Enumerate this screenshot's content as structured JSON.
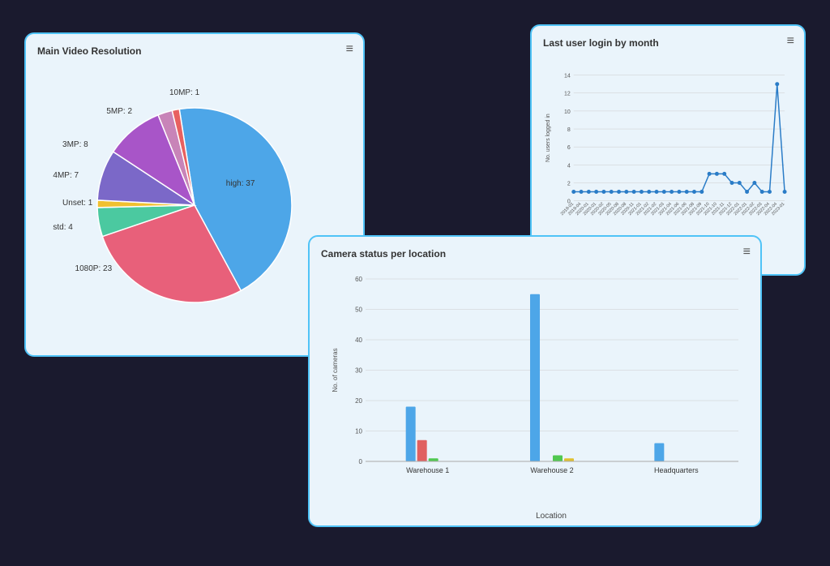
{
  "pie_card": {
    "title": "Main Video Resolution",
    "menu_icon": "≡",
    "slices": [
      {
        "label": "high: 37",
        "value": 37,
        "color": "#4da6e8",
        "labelX": "62%",
        "labelY": "44%"
      },
      {
        "label": "1080P: 23",
        "value": 23,
        "color": "#e8607a",
        "labelX": "18%",
        "labelY": "78%"
      },
      {
        "label": "std: 4",
        "value": 4,
        "color": "#4bc9a0",
        "labelX": "10%",
        "labelY": "60%"
      },
      {
        "label": "Unset: 1",
        "value": 1,
        "color": "#f0c030",
        "labelX": "11%",
        "labelY": "50%"
      },
      {
        "label": "4MP: 7",
        "value": 7,
        "color": "#7b68c8",
        "labelX": "8%",
        "labelY": "42%"
      },
      {
        "label": "3MP: 8",
        "value": 8,
        "color": "#a855c8",
        "labelX": "12%",
        "labelY": "30%"
      },
      {
        "label": "5MP: 2",
        "value": 2,
        "color": "#c884b8",
        "labelX": "20%",
        "labelY": "20%"
      },
      {
        "label": "10MP: 1",
        "value": 1,
        "color": "#e86060",
        "labelX": "38%",
        "labelY": "13%"
      }
    ]
  },
  "line_card": {
    "title": "Last user login by month",
    "menu_icon": "≡",
    "y_axis_label": "No. users logged in",
    "y_max": 14,
    "y_ticks": [
      0,
      2,
      4,
      6,
      8,
      10,
      12,
      14
    ],
    "data_points": [
      1,
      1,
      1,
      1,
      1,
      1,
      1,
      1,
      1,
      1,
      1,
      1,
      1,
      1,
      1,
      1,
      1,
      1,
      3,
      3,
      3,
      2,
      2,
      1,
      2,
      1,
      1,
      13,
      1
    ],
    "x_labels": [
      "2019-01",
      "2019-04",
      "2020-01",
      "2020-02",
      "2020-05",
      "2020-08",
      "2020-11",
      "2021-01",
      "2021-02",
      "2021-03",
      "2021-04",
      "2021-06",
      "2021-08",
      "2021-09",
      "2021-10",
      "2021-11",
      "2021-12",
      "2022-01",
      "2022-02",
      "2022-03",
      "2022-04",
      "2023-01"
    ]
  },
  "bar_card": {
    "title": "Camera status per location",
    "menu_icon": "≡",
    "y_axis_label": "No. of cameras",
    "x_axis_label": "Location",
    "y_max": 60,
    "y_ticks": [
      0,
      10,
      20,
      30,
      40,
      50,
      60
    ],
    "locations": [
      {
        "name": "Warehouse 1",
        "bars": [
          {
            "color": "#4da6e8",
            "value": 18
          },
          {
            "color": "#e06060",
            "value": 7
          },
          {
            "color": "#50c850",
            "value": 1
          },
          {
            "color": "#e0c030",
            "value": 0
          }
        ]
      },
      {
        "name": "Warehouse 2",
        "bars": [
          {
            "color": "#4da6e8",
            "value": 55
          },
          {
            "color": "#e06060",
            "value": 0
          },
          {
            "color": "#50c850",
            "value": 2
          },
          {
            "color": "#e0c030",
            "value": 1
          }
        ]
      },
      {
        "name": "Headquarters",
        "bars": [
          {
            "color": "#4da6e8",
            "value": 6
          },
          {
            "color": "#e06060",
            "value": 0
          },
          {
            "color": "#50c850",
            "value": 0
          },
          {
            "color": "#e0c030",
            "value": 0
          }
        ]
      }
    ]
  }
}
